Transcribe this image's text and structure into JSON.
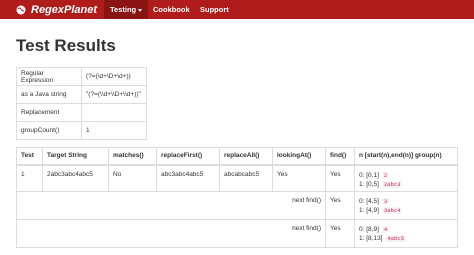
{
  "navbar": {
    "brand": "RegexPlanet",
    "items": [
      {
        "label": "Testing"
      },
      {
        "label": "Cookbook"
      },
      {
        "label": "Support"
      }
    ]
  },
  "page_title": "Test Results",
  "info": {
    "rows": [
      {
        "key": "Regular Expression",
        "value": "(?=(\\d+\\D+\\d+))"
      },
      {
        "key": "as a Java string",
        "value": "\"(?=(\\\\d+\\\\D+\\\\d+))\""
      },
      {
        "key": "Replacement",
        "value": ""
      },
      {
        "key": "groupCount()",
        "value": "1"
      }
    ]
  },
  "results": {
    "headers": [
      "Test",
      "Target String",
      "matches()",
      "replaceFirst()",
      "replaceAll()",
      "lookingAt()",
      "find()",
      "n [start(n),end(n)] group(n)"
    ],
    "row1": {
      "test": "1",
      "target": "2abc3abc4abc5",
      "matches": "No",
      "replaceFirst": "abc3abc4abc5",
      "replaceAll": "abcabcabc5",
      "lookingAt": "Yes",
      "find": "Yes",
      "groups": [
        {
          "text": "0: [0,1]",
          "badge": "2"
        },
        {
          "text": "1: [0,5]",
          "badge": "2abc3"
        }
      ]
    },
    "row2": {
      "label": "next find()",
      "find": "Yes",
      "groups": [
        {
          "text": "0: [4,5]",
          "badge": "3"
        },
        {
          "text": "1: [4,9]",
          "badge": "3abc4"
        }
      ]
    },
    "row3": {
      "label": "next find()",
      "find": "Yes",
      "groups": [
        {
          "text": "0: [8,9]",
          "badge": "4"
        },
        {
          "text": "1: [8,13]",
          "badge": "4abc5"
        }
      ]
    }
  }
}
